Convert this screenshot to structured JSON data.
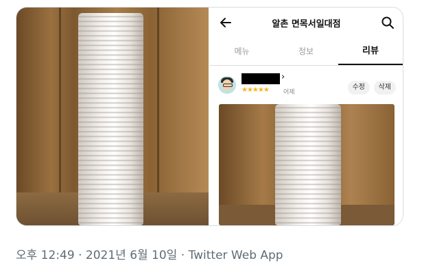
{
  "app": {
    "title": "알촌 면목서일대점",
    "tabs": [
      {
        "label": "메뉴",
        "active": false
      },
      {
        "label": "정보",
        "active": false
      },
      {
        "label": "리뷰",
        "active": true
      }
    ]
  },
  "review": {
    "name_suffix": "›",
    "stars": "★★★★★",
    "rating": 5,
    "date": "어제",
    "edit_label": "수정",
    "delete_label": "삭제"
  },
  "tweet_meta": {
    "timestamp": "오후 12:49 · 2021년 6월 10일 · Twitter Web App"
  },
  "icons": [
    "back-arrow-icon",
    "search-icon",
    "star-icon"
  ],
  "colors": {
    "star": "#f6b21a",
    "meta_text": "#5f6b75",
    "border": "#d6dde3"
  }
}
